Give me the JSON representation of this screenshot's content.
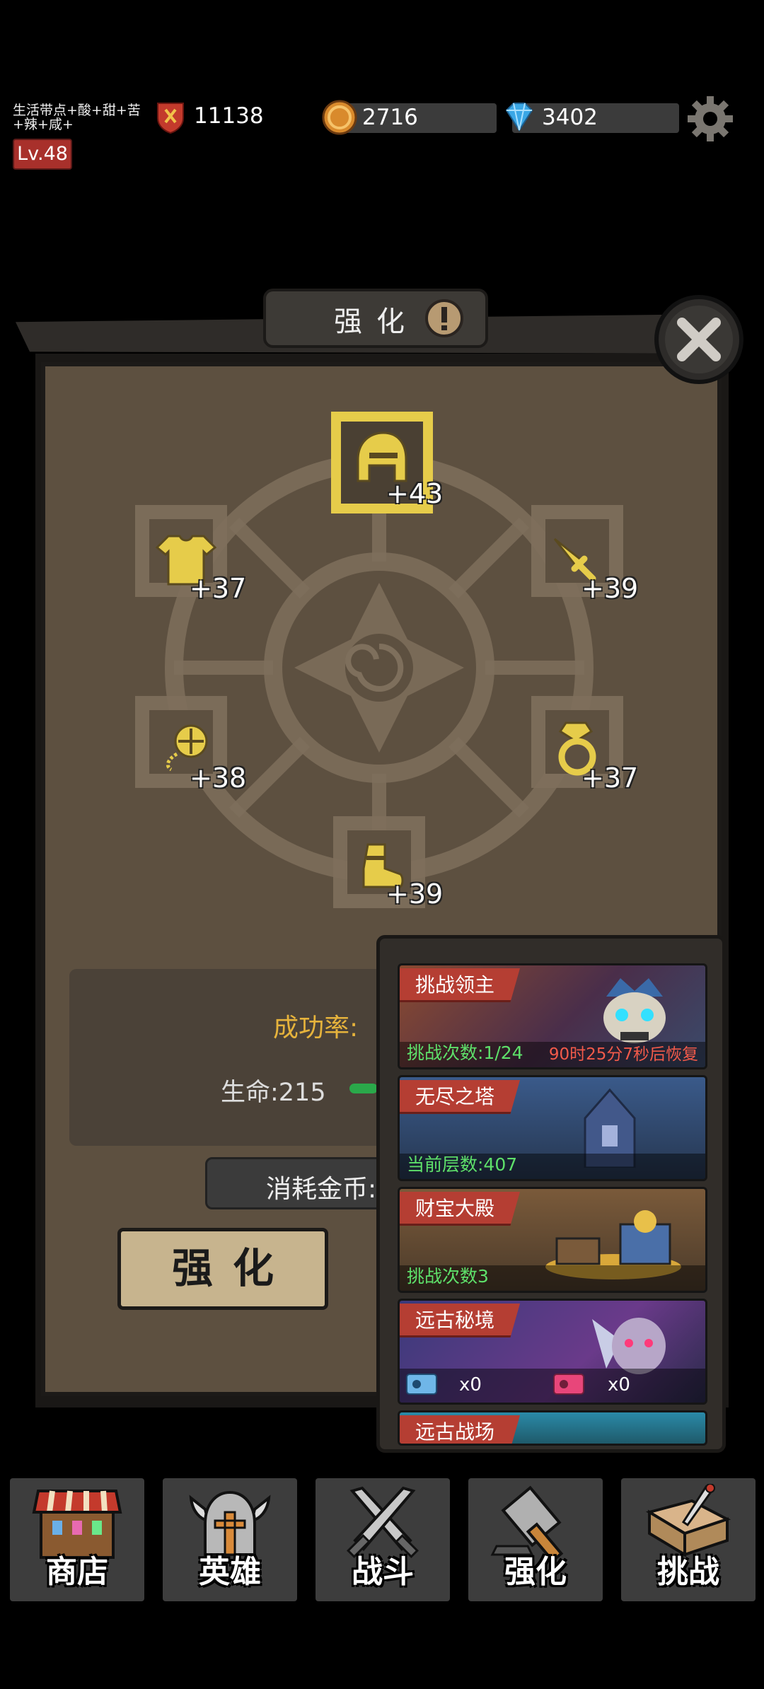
{
  "status": {
    "player_name": "生活带点+酸+甜+苦+辣+咸+",
    "power": "11138",
    "level": "Lv.48",
    "gold": "2716",
    "gems": "3402"
  },
  "panel": {
    "title": "强化"
  },
  "equipment": {
    "helmet": "+43",
    "armor": "+37",
    "weapon": "+39",
    "amulet": "+38",
    "ring": "+37",
    "boots": "+39"
  },
  "stats": {
    "success_rate_label": "成功率:",
    "hp_label": "生命:215",
    "cost_label": "消耗金币:",
    "enhance_button": "强化"
  },
  "challenges": [
    {
      "title": "挑战领主",
      "info_left": "挑战次数:1/24",
      "info_right": "90时25分7秒后恢复"
    },
    {
      "title": "无尽之塔",
      "info_left": "当前层数:407"
    },
    {
      "title": "财宝大殿",
      "info_left": "挑战次数3"
    },
    {
      "title": "远古秘境",
      "ticket_a": "x0",
      "ticket_b": "x0"
    },
    {
      "title": "远古战场"
    }
  ],
  "nav": {
    "shop": "商店",
    "hero": "英雄",
    "battle": "战斗",
    "enhance": "强化",
    "challenge": "挑战"
  },
  "colors": {
    "highlight": "#e6cc4a",
    "tag_red": "#b53e33",
    "success_gold": "#e6b33c",
    "green_text": "#5ee06a",
    "red_text": "#f25a4a"
  }
}
